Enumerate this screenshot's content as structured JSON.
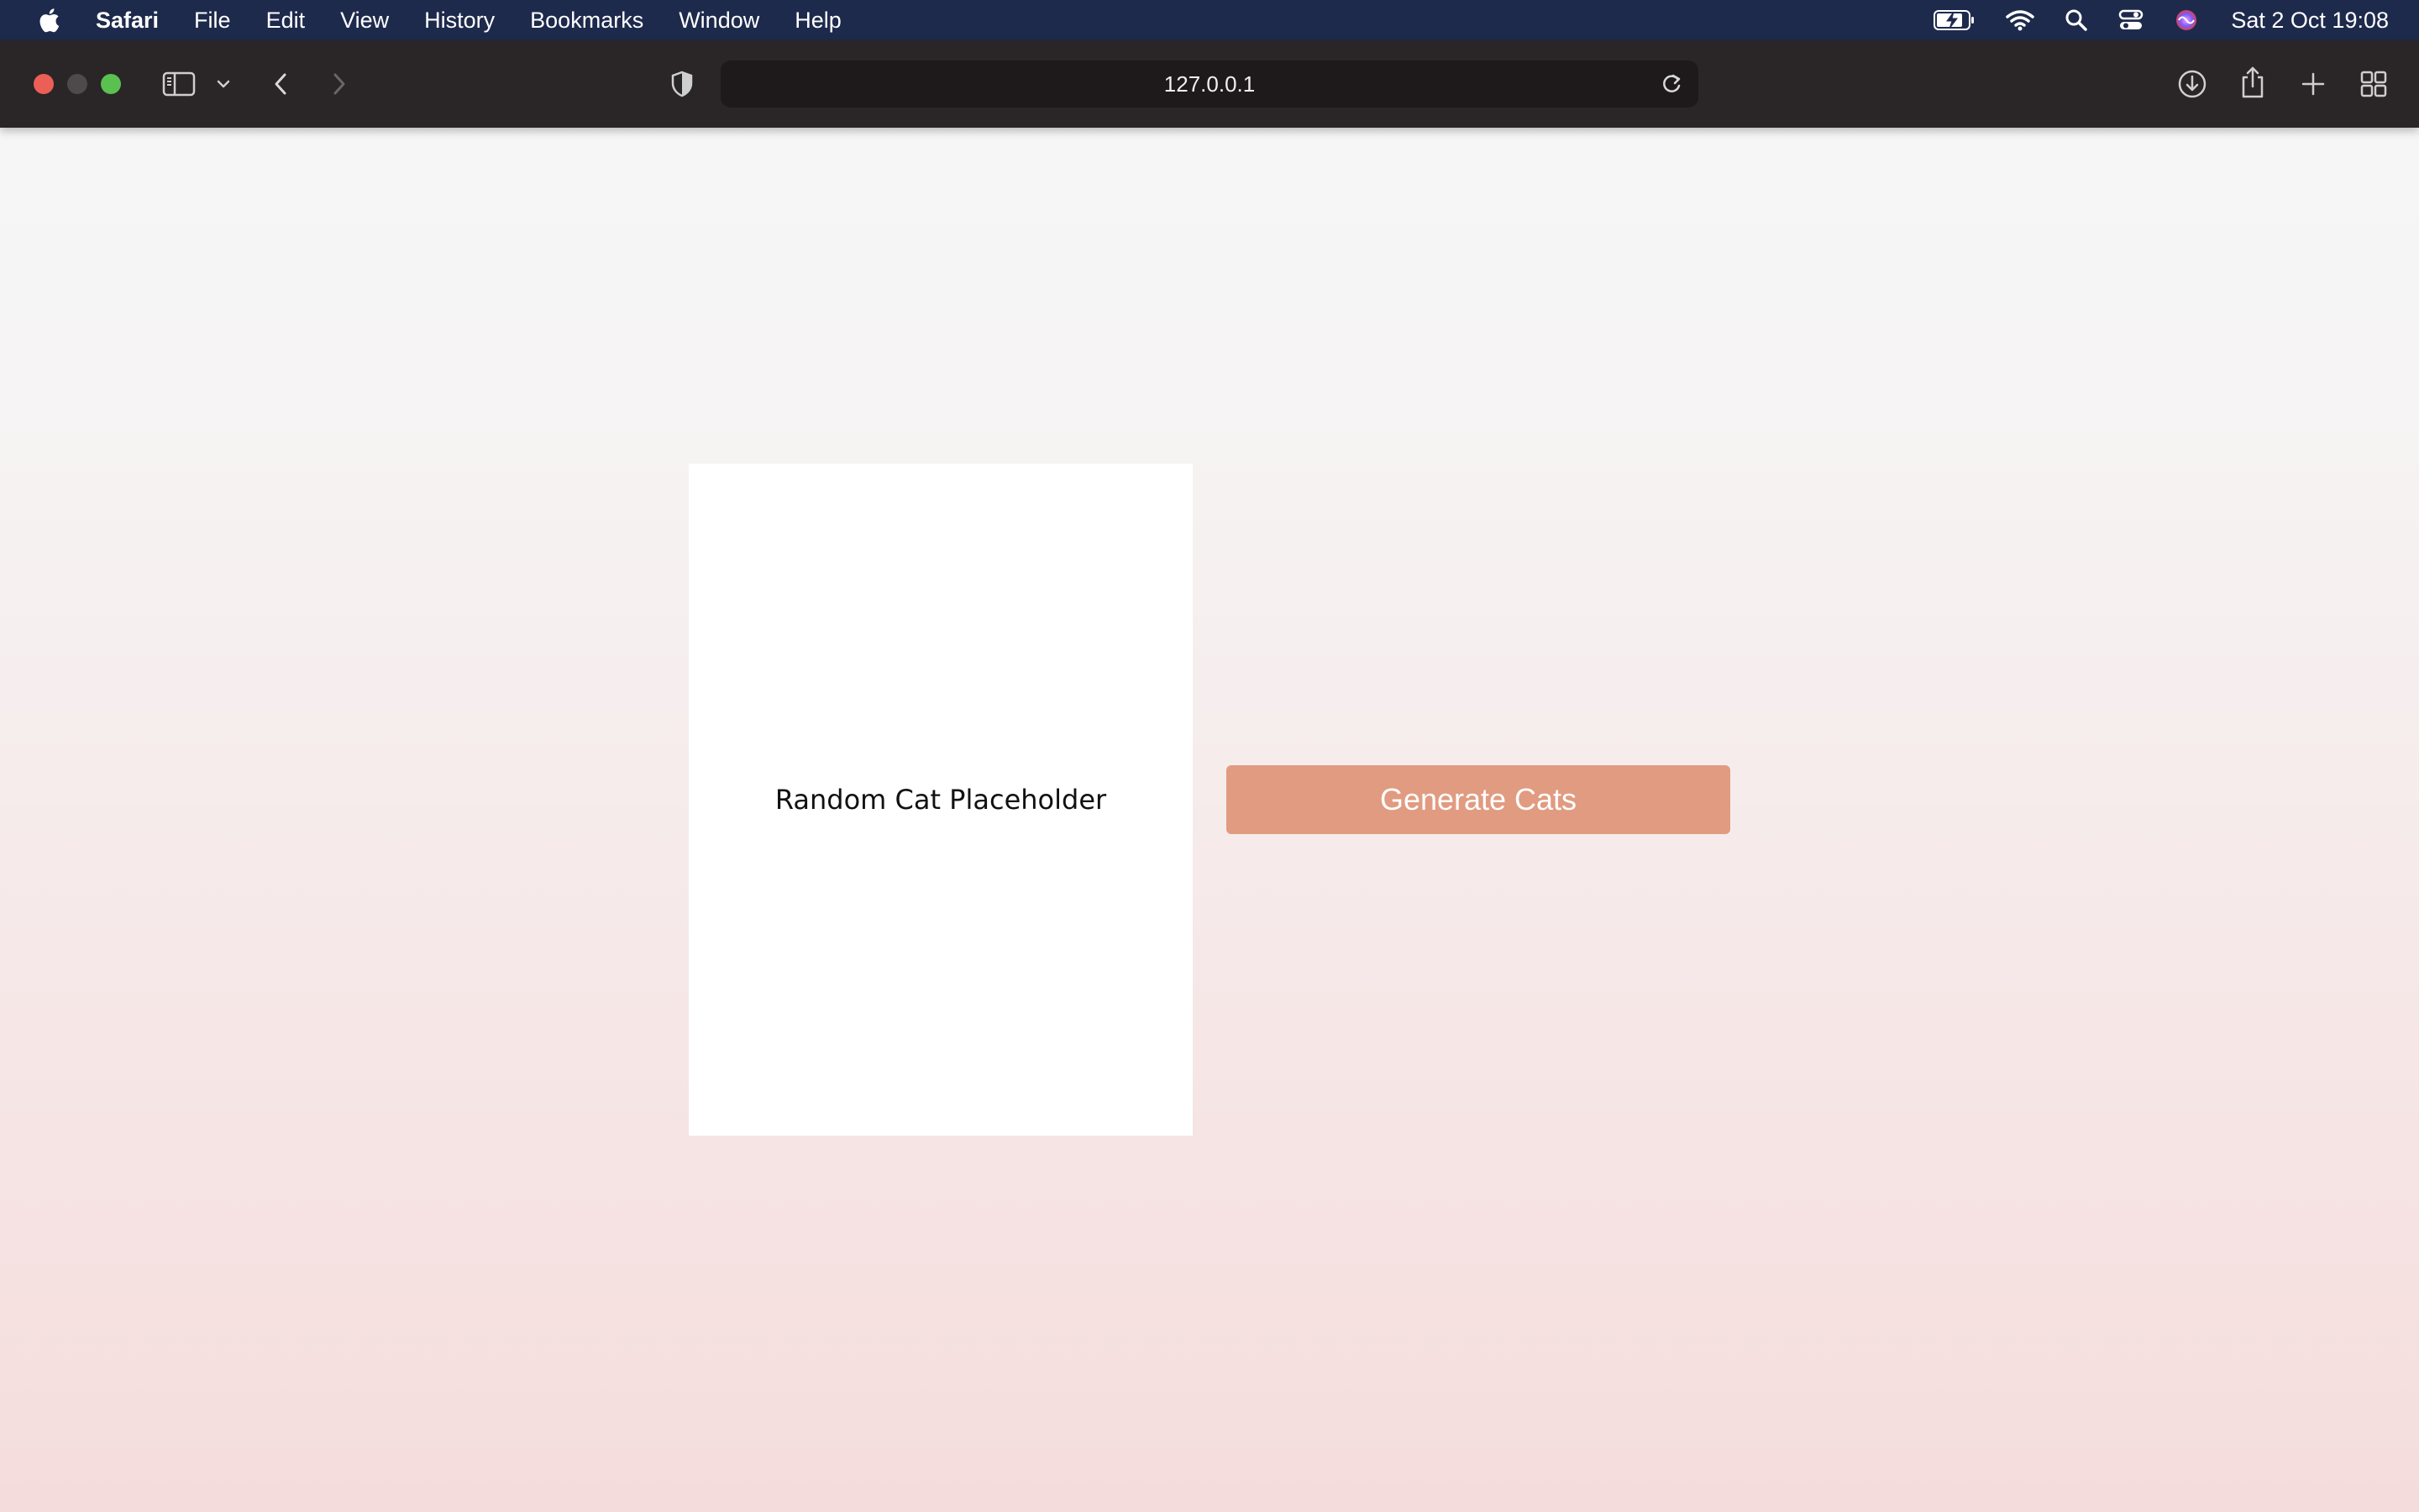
{
  "menubar": {
    "apple_icon": "apple-logo-icon",
    "items": [
      "Safari",
      "File",
      "Edit",
      "View",
      "History",
      "Bookmarks",
      "Window",
      "Help"
    ],
    "status_icons": [
      "battery-charging-icon",
      "wifi-icon",
      "spotlight-search-icon",
      "control-center-icon",
      "siri-icon"
    ],
    "clock": "Sat 2 Oct  19:08"
  },
  "toolbar": {
    "url": "127.0.0.1",
    "icons": [
      "sidebar-toggle-icon",
      "chevron-down-icon",
      "back-icon",
      "forward-icon",
      "privacy-shield-icon",
      "reload-icon",
      "downloads-icon",
      "share-icon",
      "new-tab-icon",
      "tab-overview-icon"
    ]
  },
  "page": {
    "placeholder_text": "Random Cat Placeholder",
    "button_label": "Generate Cats"
  },
  "colors": {
    "menubar_bg": "#1e2a4c",
    "toolbar_bg": "#2a2526",
    "button_bg": "#e19b81",
    "traffic_close": "#ec5f57",
    "traffic_max": "#5ac150"
  }
}
